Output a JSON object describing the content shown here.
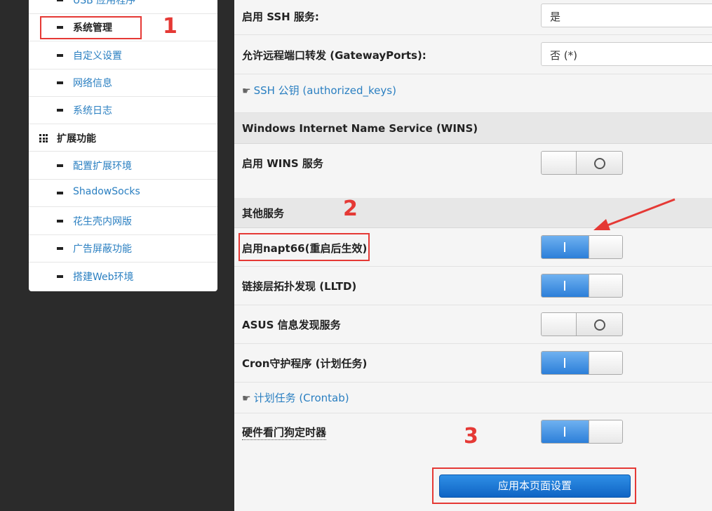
{
  "sidebar": {
    "items": [
      {
        "label": "USB 应用程序"
      },
      {
        "label": "系统管理"
      },
      {
        "label": "自定义设置"
      },
      {
        "label": "网络信息"
      },
      {
        "label": "系统日志"
      }
    ],
    "group": {
      "label": "扩展功能",
      "icon": "grid-icon"
    },
    "group_items": [
      {
        "label": "配置扩展环境"
      },
      {
        "label": "ShadowSocks"
      },
      {
        "label": "花生壳内网版"
      },
      {
        "label": "广告屏蔽功能"
      },
      {
        "label": "搭建Web环境"
      }
    ]
  },
  "main": {
    "ssh_enable": {
      "label": "启用 SSH 服务:",
      "value": "是"
    },
    "gateway_ports": {
      "label": "允许远程端口转发 (GatewayPorts):",
      "value": "否 (*)"
    },
    "ssh_keys_link": {
      "label": "SSH 公钥 (authorized_keys)",
      "icon": "hand-pointer-icon"
    },
    "wins_section": {
      "label": "Windows Internet Name Service (WINS)"
    },
    "wins_enable": {
      "label": "启用 WINS 服务",
      "state": "off"
    },
    "other_section": {
      "label": "其他服务"
    },
    "napt66": {
      "label": "启用napt66(重启后生效)",
      "state": "on"
    },
    "lltd": {
      "label": "链接层拓扑发现 (LLTD)",
      "state": "on"
    },
    "asus_discovery": {
      "label": "ASUS 信息发现服务",
      "state": "off"
    },
    "cron": {
      "label": "Cron守护程序 (计划任务)",
      "state": "on"
    },
    "crontab_link": {
      "label": "计划任务 (Crontab)",
      "icon": "hand-pointer-icon"
    },
    "watchdog": {
      "label": "硬件看门狗定时器",
      "state": "on"
    },
    "apply_button": {
      "label": "应用本页面设置"
    }
  },
  "annotations": {
    "step1": "1",
    "step2": "2",
    "step3": "3",
    "color": "#e53935"
  },
  "colors": {
    "accent": "#2a7fc1",
    "toggle_on": "#2c7fd9",
    "button": "#0f64c4"
  }
}
